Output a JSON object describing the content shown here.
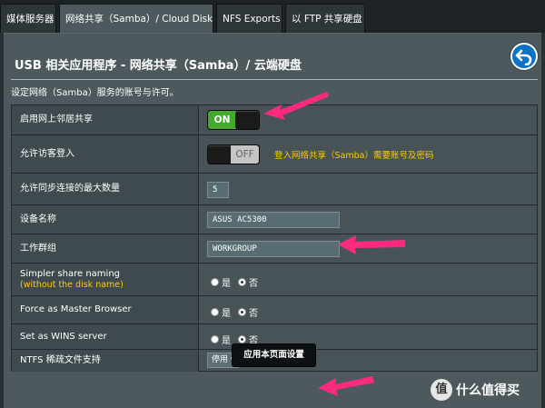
{
  "tabs": [
    {
      "label": "媒体服务器",
      "active": false
    },
    {
      "label": "网络共享（Samba）/ Cloud Disk",
      "active": true
    },
    {
      "label": "NFS Exports",
      "active": false
    },
    {
      "label": "以 FTP 共享硬盘",
      "active": false
    }
  ],
  "page": {
    "title": "USB 相关应用程序 - 网络共享（Samba）/ 云端硬盘",
    "description": "设定网络（Samba）服务的账号与许可。",
    "back_icon": "back-arrow-icon"
  },
  "rows": {
    "network_neighborhood": {
      "label": "启用网上邻居共享",
      "toggle": "ON"
    },
    "guest_login": {
      "label": "允许访客登入",
      "toggle": "OFF",
      "hint": "登入网络共享（Samba）需要账号及密码"
    },
    "max_connections": {
      "label": "允许同步连接的最大数量",
      "value": "5"
    },
    "device_name": {
      "label": "设备名称",
      "value": "ASUS AC5300"
    },
    "workgroup": {
      "label": "工作群组",
      "value": "WORKGROUP"
    },
    "simpler_naming": {
      "label": "Simpler share naming",
      "sublabel": "(without the disk name)",
      "yes": "是",
      "no": "否",
      "selected": "no"
    },
    "master_browser": {
      "label": "Force as Master Browser",
      "yes": "是",
      "no": "否",
      "selected": "no"
    },
    "wins_server": {
      "label": "Set as WINS server",
      "yes": "是",
      "no": "否",
      "selected": "no"
    },
    "ntfs_sparse": {
      "label": "NTFS 稀疏文件支持",
      "value": "停用 ▾"
    }
  },
  "apply_button": "应用本页面设置",
  "watermark": {
    "badge": "值",
    "text": "什么值得买"
  },
  "colors": {
    "toggle_on": "#45a92b",
    "hint": "#ffcc00",
    "arrow": "#ff2a7f",
    "accent_blue": "#0b72c6"
  }
}
